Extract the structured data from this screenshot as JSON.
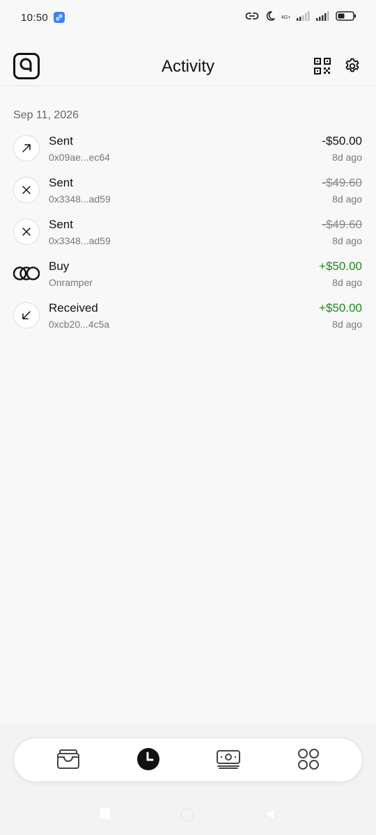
{
  "status_bar": {
    "time": "10:50",
    "network_label": "4G+",
    "battery_level": 0.45
  },
  "header": {
    "title": "Activity"
  },
  "activity": {
    "date": "Sep 11, 2026",
    "items": [
      {
        "kind": "sent",
        "icon": "arrow-up-right-icon",
        "title": "Sent",
        "subtitle": "0x09ae...ec64",
        "amount": "-$50.00",
        "status": "normal",
        "time": "8d ago"
      },
      {
        "kind": "failed",
        "icon": "x-icon",
        "title": "Sent",
        "subtitle": "0x3348...ad59",
        "amount": "-$49.60",
        "status": "failed",
        "time": "8d ago"
      },
      {
        "kind": "failed",
        "icon": "x-icon",
        "title": "Sent",
        "subtitle": "0x3348...ad59",
        "amount": "-$49.60",
        "status": "failed",
        "time": "8d ago"
      },
      {
        "kind": "buy",
        "icon": "onramper-logo-icon",
        "title": "Buy",
        "subtitle": "Onramper",
        "amount": "+$50.00",
        "status": "positive",
        "time": "8d ago"
      },
      {
        "kind": "received",
        "icon": "arrow-down-left-icon",
        "title": "Received",
        "subtitle": "0xcb20...4c5a",
        "amount": "+$50.00",
        "status": "positive",
        "time": "8d ago"
      }
    ]
  },
  "bottom_nav": {
    "items": [
      {
        "name": "wallet",
        "icon": "wallet-icon",
        "active": false
      },
      {
        "name": "activity",
        "icon": "clock-icon",
        "active": true
      },
      {
        "name": "cash",
        "icon": "cash-icon",
        "active": false
      },
      {
        "name": "apps",
        "icon": "apps-grid-icon",
        "active": false
      }
    ]
  },
  "colors": {
    "positive": "#1e8a1e",
    "failed": "#8a8a8a",
    "text": "#111111",
    "muted": "#777777",
    "link_badge": "#3b82f6"
  }
}
